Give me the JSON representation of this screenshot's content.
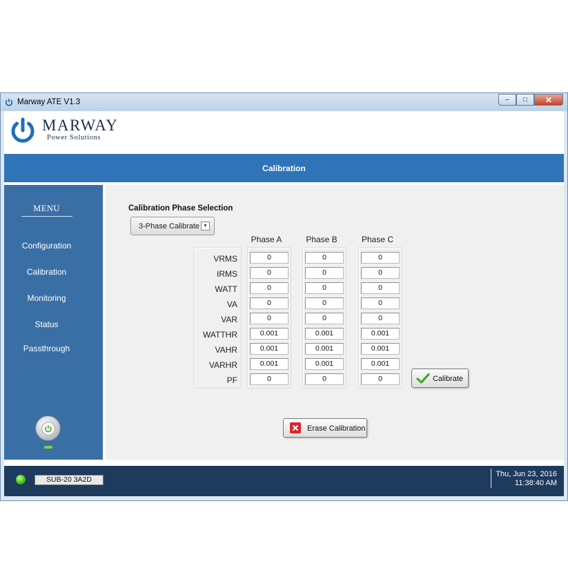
{
  "window": {
    "title": "Marway ATE V1.3",
    "minimize_label": "–",
    "maximize_label": "□",
    "close_label": "✕"
  },
  "logo": {
    "name": "MARWAY",
    "subtitle": "Power Solutions"
  },
  "header": {
    "title": "Calibration"
  },
  "sidebar": {
    "menu_title": "MENU",
    "items": [
      {
        "label": "Configuration"
      },
      {
        "label": "Calibration"
      },
      {
        "label": "Monitoring"
      },
      {
        "label": "Status"
      },
      {
        "label": "Passthrough"
      }
    ]
  },
  "calibration": {
    "phase_selection_label": "Calibration Phase Selection",
    "phase_selection_value": "3-Phase Calibrate",
    "row_labels": [
      "VRMS",
      "IRMS",
      "WATT",
      "VA",
      "VAR",
      "WATTHR",
      "VAHR",
      "VARHR",
      "PF"
    ],
    "phases": [
      {
        "name": "Phase A",
        "values": [
          "0",
          "0",
          "0",
          "0",
          "0",
          "0.001",
          "0.001",
          "0.001",
          "0"
        ]
      },
      {
        "name": "Phase B",
        "values": [
          "0",
          "0",
          "0",
          "0",
          "0",
          "0.001",
          "0.001",
          "0.001",
          "0"
        ]
      },
      {
        "name": "Phase C",
        "values": [
          "0",
          "0",
          "0",
          "0",
          "0",
          "0.001",
          "0.001",
          "0.001",
          "0"
        ]
      }
    ],
    "calibrate_button": "Calibrate",
    "erase_button": "Erase Calibration"
  },
  "status": {
    "device": "SUB-20  3A2D",
    "date": "Thu, Jun 23, 2016",
    "time": "11:38:40 AM"
  },
  "colors": {
    "header_blue": "#2e74b6",
    "sidebar_blue": "#3a6fa6",
    "status_bar": "#1e3a5c",
    "status_led": "#3dbb19",
    "erase_icon_red": "#d7262b",
    "calibrate_check_green": "#4aa52a"
  },
  "icons": {
    "app": "marway-power-icon",
    "logo": "marway-power-logo",
    "power_button": "power-icon",
    "calibrate": "check-icon",
    "erase": "x-mark-icon",
    "dropdown": "chevron-down-icon"
  }
}
